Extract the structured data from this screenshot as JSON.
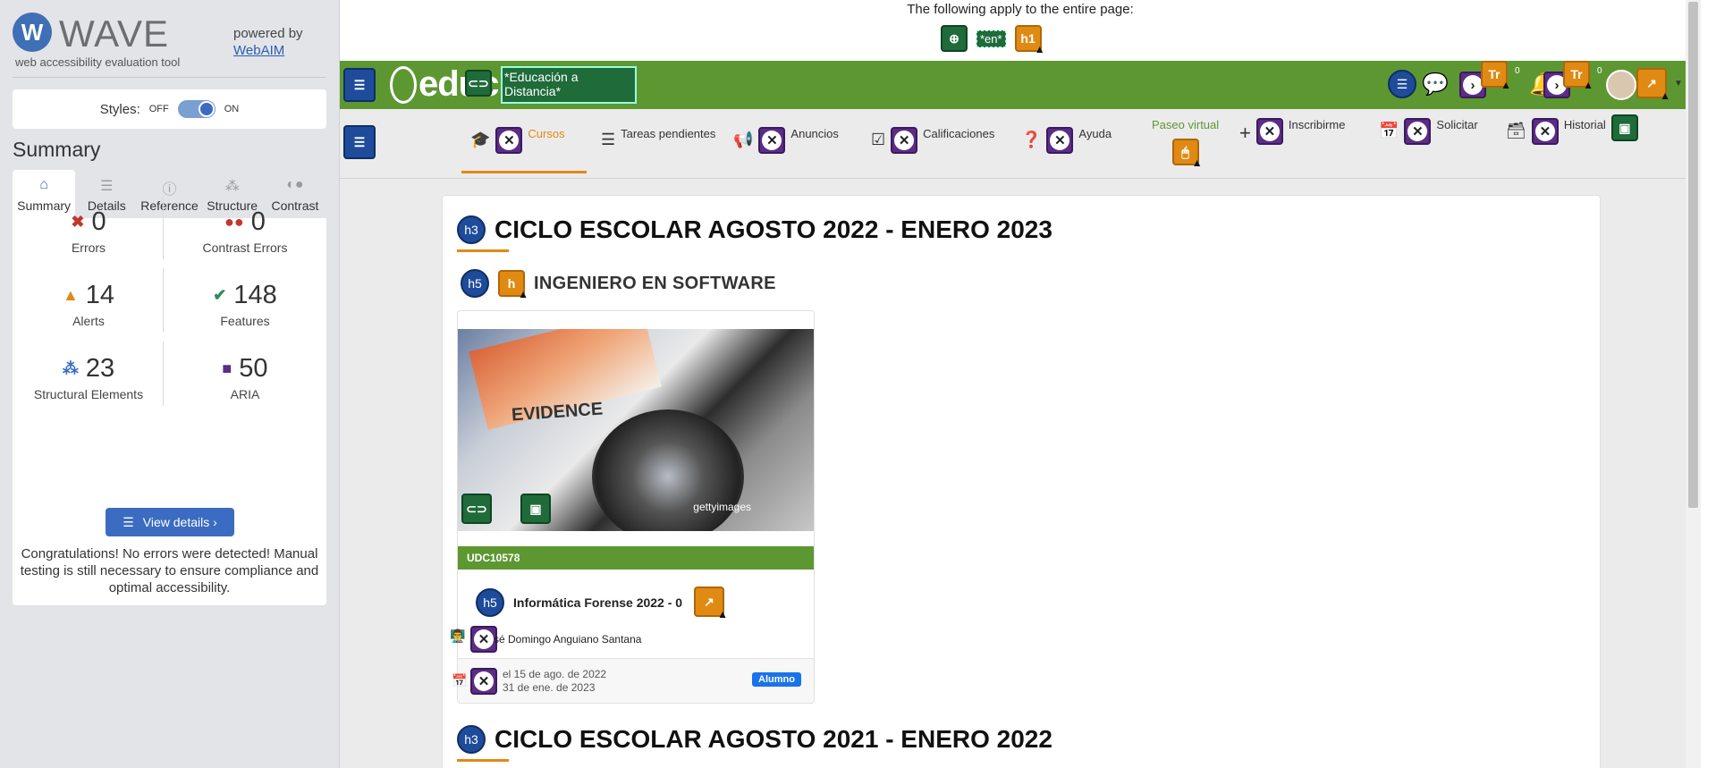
{
  "wave": {
    "logo_word": "WAVE",
    "tagline": "web accessibility evaluation tool",
    "powered_by": "powered by",
    "webaim_link": "WebAIM",
    "styles_label": "Styles:",
    "styles_off": "OFF",
    "styles_on": "ON",
    "summary_title": "Summary",
    "tabs": [
      {
        "label": "Summary",
        "icon": "home-icon"
      },
      {
        "label": "Details",
        "icon": "list-icon"
      },
      {
        "label": "Reference",
        "icon": "info-icon"
      },
      {
        "label": "Structure",
        "icon": "structure-icon"
      },
      {
        "label": "Contrast",
        "icon": "contrast-icon"
      }
    ],
    "stats": {
      "errors": {
        "value": "0",
        "label": "Errors",
        "color": "#c0392b"
      },
      "contrast_errors": {
        "value": "0",
        "label": "Contrast Errors",
        "color": "#c0392b"
      },
      "alerts": {
        "value": "14",
        "label": "Alerts",
        "color": "#e08a14"
      },
      "features": {
        "value": "148",
        "label": "Features",
        "color": "#2e8b57"
      },
      "structural": {
        "value": "23",
        "label": "Structural Elements",
        "color": "#3b6cc1"
      },
      "aria": {
        "value": "50",
        "label": "ARIA",
        "color": "#5b2d86"
      }
    },
    "view_details": "View details ›",
    "congrats": "Congratulations! No errors were detected! Manual testing is still necessary to ensure compliance and optimal accessibility."
  },
  "page": {
    "applies_text": "The following apply to the entire page:",
    "lang_badge": "*en*",
    "h1_badge": "h1",
    "brand": "educ",
    "site_title": "*Educación a Distancia*",
    "tr_badge": "Tr",
    "tr_count": "0",
    "nav": [
      {
        "label": "Cursos",
        "icon": "graduation-cap-icon"
      },
      {
        "label": "Tareas pendientes",
        "icon": "tasks-icon"
      },
      {
        "label": "Anuncios",
        "icon": "megaphone-icon"
      },
      {
        "label": "Calificaciones",
        "icon": "checkbox-icon"
      },
      {
        "label": "Ayuda",
        "icon": "question-icon"
      },
      {
        "label": "Paseo virtual",
        "icon": "mouse-icon"
      },
      {
        "label": "Inscribirme",
        "icon": "plus-icon"
      },
      {
        "label": "Solicitar",
        "icon": "calendar-plus-icon"
      },
      {
        "label": "Historial",
        "icon": "archive-icon"
      }
    ],
    "cycle_1": "CICLO ESCOLAR AGOSTO 2022 - ENERO 2023",
    "cycle_2": "CICLO ESCOLAR AGOSTO 2021 - ENERO 2022",
    "h3_badge": "h3",
    "h5_badge": "h5",
    "program": "INGENIERO EN SOFTWARE",
    "course": {
      "image_text": "EVIDENCE",
      "image_watermark": "gettyimages",
      "code": "UDC10578",
      "title": "Informática Forense 2022 - 0",
      "teacher": "sé Domingo Anguiano Santana",
      "date_start": "el 15 de ago. de 2022",
      "date_end": "31 de ene. de 2023",
      "role": "Alumno"
    }
  }
}
